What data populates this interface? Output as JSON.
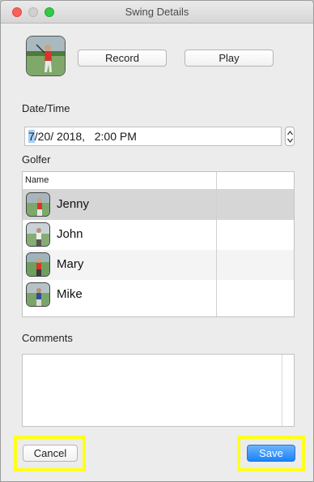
{
  "window": {
    "title": "Swing Details"
  },
  "media": {
    "record_label": "Record",
    "play_label": "Play"
  },
  "datetime": {
    "label": "Date/Time",
    "month": "7",
    "rest": "/20/ 2018,   2:00 PM"
  },
  "golfer": {
    "label": "Golfer",
    "column_header": "Name",
    "rows": [
      {
        "name": "Jenny"
      },
      {
        "name": "John"
      },
      {
        "name": "Mary"
      },
      {
        "name": "Mike"
      }
    ]
  },
  "comments": {
    "label": "Comments",
    "value": ""
  },
  "footer": {
    "cancel_label": "Cancel",
    "save_label": "Save"
  },
  "colors": {
    "highlight": "#ffff1e",
    "accent": "#1a82fb",
    "selected_row": "#d6d6d6"
  },
  "icons": [
    "golfer-thumbnail",
    "stepper-icon"
  ]
}
